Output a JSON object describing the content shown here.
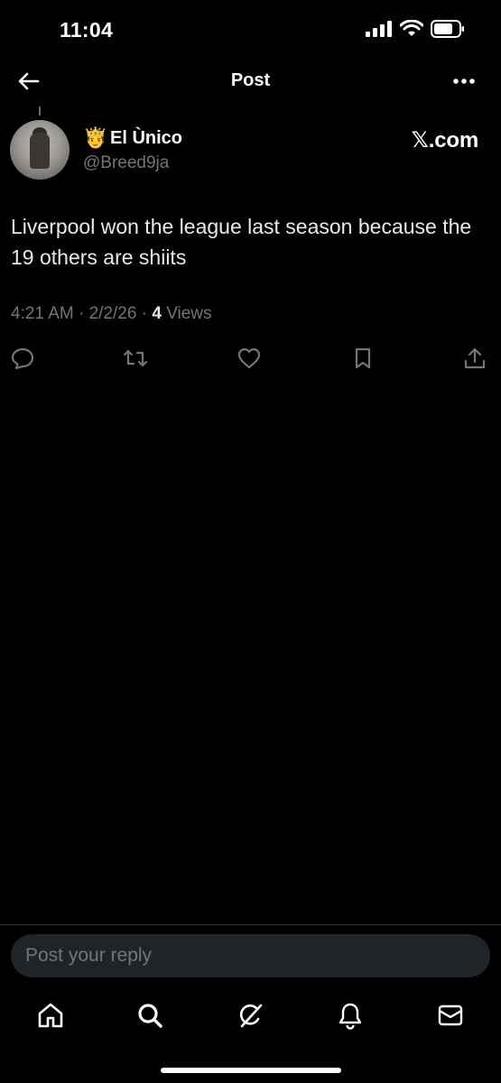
{
  "status_bar": {
    "time": "11:04",
    "icons": [
      "signal-icon",
      "wifi-icon",
      "battery-icon"
    ]
  },
  "header": {
    "title": "Post",
    "back_icon": "arrow-left-icon",
    "more_icon": "more-horizontal-icon"
  },
  "post": {
    "author": {
      "emoji": "🤴",
      "display_name": "El Ùnico",
      "handle": "@Breed9ja"
    },
    "source_badge": "𝕏.com",
    "text": "Liverpool won the league last season because the 19 others are shiits",
    "time": "4:21 AM",
    "date": "2/2/26",
    "views_count": "4",
    "views_label": "Views",
    "separator": "·",
    "actions": [
      "reply-icon",
      "repost-icon",
      "like-icon",
      "bookmark-icon",
      "share-icon"
    ]
  },
  "reply": {
    "placeholder": "Post your reply"
  },
  "bottom_nav": {
    "items": [
      "home-icon",
      "search-icon",
      "grok-icon",
      "notifications-icon",
      "messages-icon"
    ]
  },
  "colors": {
    "background": "#000000",
    "text_primary": "#e7e9ea",
    "text_secondary": "#71767b",
    "input_bg": "#202327",
    "divider": "#2f3336"
  }
}
